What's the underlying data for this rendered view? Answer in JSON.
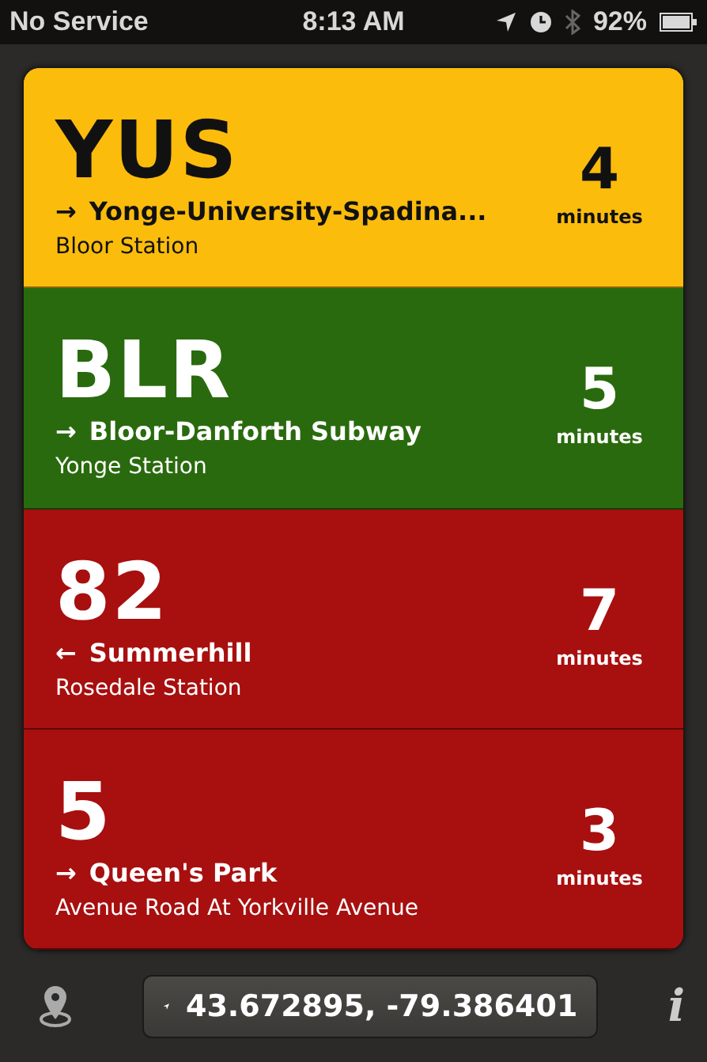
{
  "status_bar": {
    "carrier": "No Service",
    "time": "8:13 AM",
    "battery": "92%"
  },
  "arrivals": [
    {
      "route": "YUS",
      "direction_arrow": "→",
      "destination": "Yonge-University-Spadina...",
      "stop": "Bloor Station",
      "minutes": "4",
      "unit": "minutes",
      "color": "#fbbc0c"
    },
    {
      "route": "BLR",
      "direction_arrow": "→",
      "destination": "Bloor-Danforth Subway",
      "stop": "Yonge Station",
      "minutes": "5",
      "unit": "minutes",
      "color": "#2a6a0e"
    },
    {
      "route": "82",
      "direction_arrow": "←",
      "destination": "Summerhill",
      "stop": "Rosedale Station",
      "minutes": "7",
      "unit": "minutes",
      "color": "#a80f0f"
    },
    {
      "route": "5",
      "direction_arrow": "→",
      "destination": "Queen's Park",
      "stop": "Avenue Road At Yorkville Avenue",
      "minutes": "3",
      "unit": "minutes",
      "color": "#a80f0f"
    }
  ],
  "toolbar": {
    "coordinates": "43.672895, -79.386401",
    "info": "i"
  }
}
